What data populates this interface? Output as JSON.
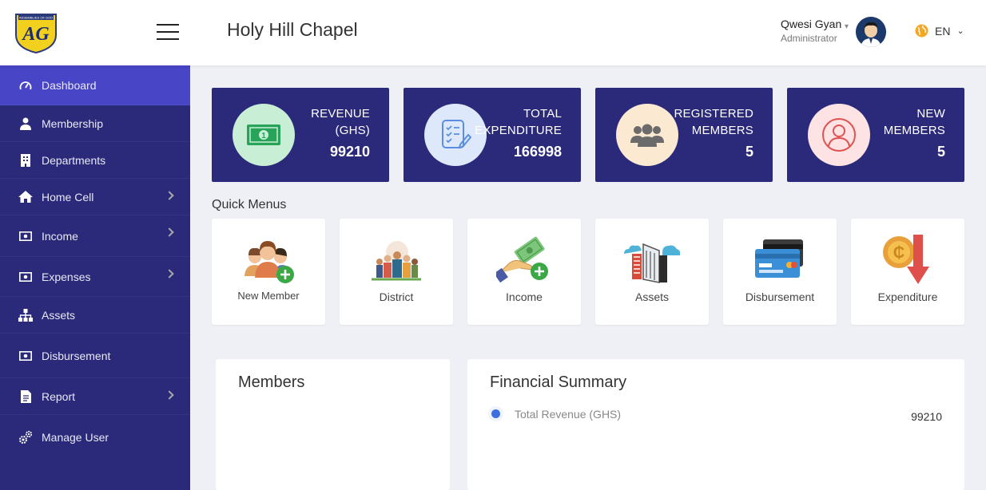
{
  "header": {
    "logo_text": "AG",
    "logo_caption": "ASSEMBLIES OF GOD",
    "title": "Holy Hill Chapel",
    "user_name": "Qwesi Gyan",
    "user_role": "Administrator",
    "language": "EN"
  },
  "sidebar": {
    "items": [
      {
        "label": "Dashboard",
        "icon": "speedometer-icon",
        "active": true
      },
      {
        "label": "Membership",
        "icon": "user-icon"
      },
      {
        "label": "Departments",
        "icon": "building-icon"
      },
      {
        "label": "Home Cell",
        "icon": "home-icon",
        "has_submenu": true
      },
      {
        "label": "Income",
        "icon": "money-icon",
        "has_submenu": true
      },
      {
        "label": "Expenses",
        "icon": "money-icon",
        "has_submenu": true
      },
      {
        "label": "Assets",
        "icon": "sitemap-icon"
      },
      {
        "label": "Disbursement",
        "icon": "money-icon"
      },
      {
        "label": "Report",
        "icon": "document-icon",
        "has_submenu": true
      },
      {
        "label": "Manage User",
        "icon": "cogs-icon"
      }
    ]
  },
  "stats": [
    {
      "label1": "REVENUE",
      "label2": "(GHS)",
      "value": "99210",
      "icon": "cash-icon",
      "circle_color": "#c8eed6"
    },
    {
      "label1": "TOTAL",
      "label2": "EXPENDITURE",
      "value": "166998",
      "icon": "checklist-icon",
      "circle_color": "#dde9fb"
    },
    {
      "label1": "REGISTERED",
      "label2": "MEMBERS",
      "value": "5",
      "icon": "group-icon",
      "circle_color": "#fbe9d2"
    },
    {
      "label1": "NEW",
      "label2": "MEMBERS",
      "value": "5",
      "icon": "person-outline-icon",
      "circle_color": "#fde3e3"
    }
  ],
  "quick_menus": {
    "title": "Quick Menus",
    "items": [
      {
        "label": "New Member",
        "icon": "new-member-icon"
      },
      {
        "label": "District",
        "icon": "district-icon"
      },
      {
        "label": "Income",
        "icon": "income-icon"
      },
      {
        "label": "Assets",
        "icon": "assets-icon"
      },
      {
        "label": "Disbursement",
        "icon": "disbursement-icon"
      },
      {
        "label": "Expenditure",
        "icon": "expenditure-icon"
      }
    ]
  },
  "members_panel": {
    "title": "Members"
  },
  "financial_summary": {
    "title": "Financial Summary",
    "rows": [
      {
        "label": "Total Revenue (GHS)",
        "value": "99210"
      }
    ]
  },
  "colors": {
    "sidebar_bg": "#2b2a7a",
    "sidebar_active": "#4845c7",
    "card_bg": "#2b2a7a",
    "page_bg": "#eef0f5"
  }
}
